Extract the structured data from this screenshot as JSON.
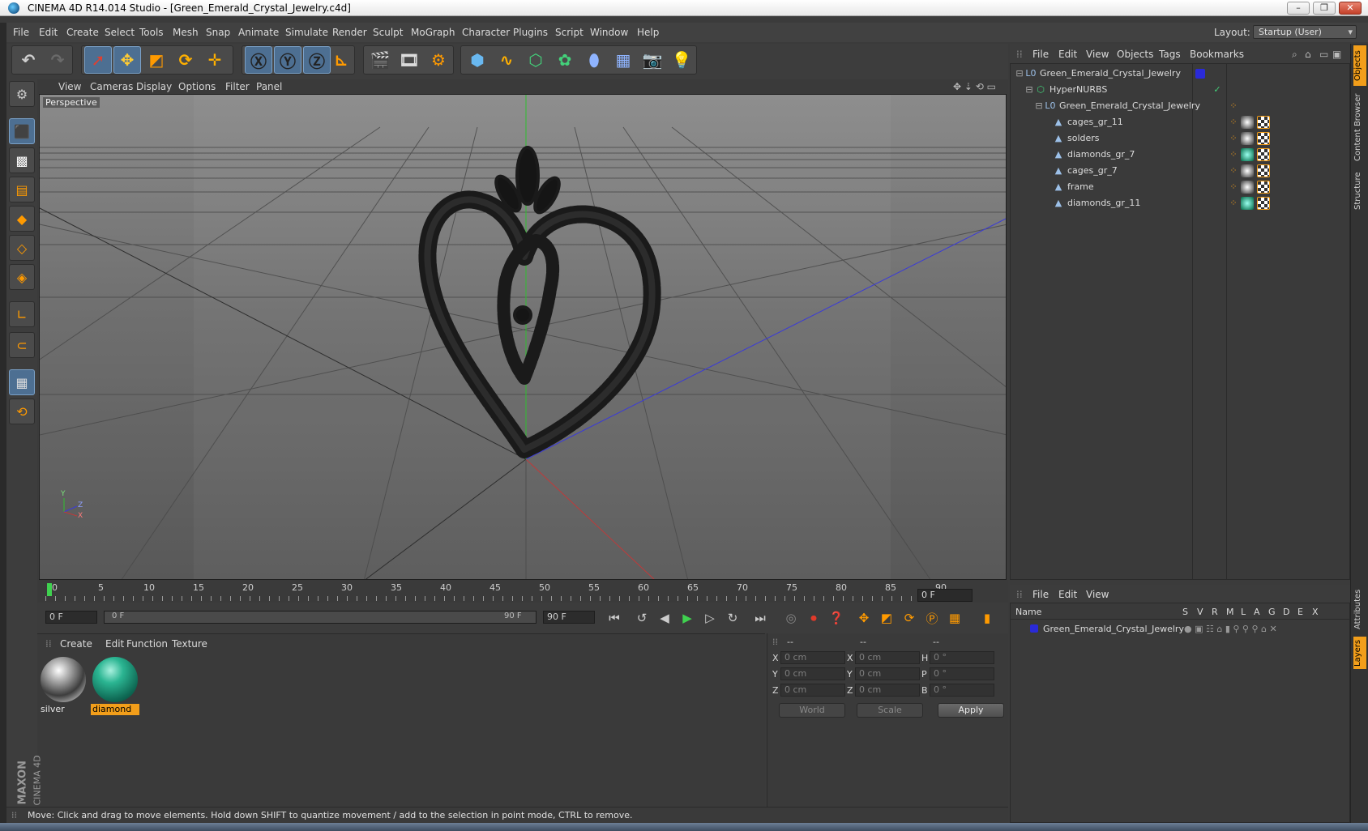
{
  "window": {
    "title": "CINEMA 4D R14.014 Studio - [Green_Emerald_Crystal_Jewelry.c4d]"
  },
  "menubar": {
    "items": [
      "File",
      "Edit",
      "Create",
      "Select",
      "Tools",
      "Mesh",
      "Snap",
      "Animate",
      "Simulate",
      "Render",
      "Sculpt",
      "MoGraph",
      "Character",
      "Plugins",
      "Script",
      "Window",
      "Help"
    ],
    "layout_label": "Layout:",
    "layout_value": "Startup (User)"
  },
  "viewport": {
    "menu": [
      "View",
      "Cameras",
      "Display",
      "Options",
      "Filter",
      "Panel"
    ],
    "label": "Perspective",
    "axis_labels": {
      "y": "Y",
      "z": "Z",
      "x": "X"
    }
  },
  "timeline": {
    "ticks": [
      "0",
      "5",
      "10",
      "15",
      "20",
      "25",
      "30",
      "35",
      "40",
      "45",
      "50",
      "55",
      "60",
      "65",
      "70",
      "75",
      "80",
      "85",
      "90"
    ],
    "current_frame": "0 F",
    "start_field": "0 F",
    "range_start": "0 F",
    "range_end": "90 F",
    "end_field": "90 F"
  },
  "materials": {
    "menu": [
      "Create",
      "Edit",
      "Function",
      "Texture"
    ],
    "items": [
      {
        "name": "silver",
        "selected": false
      },
      {
        "name": "diamond",
        "selected": true
      }
    ]
  },
  "coordinates": {
    "headers": [
      "--",
      "--",
      "--"
    ],
    "rows": [
      {
        "l1": "X",
        "v1": "0 cm",
        "l2": "X",
        "v2": "0 cm",
        "l3": "H",
        "v3": "0 °"
      },
      {
        "l1": "Y",
        "v1": "0 cm",
        "l2": "Y",
        "v2": "0 cm",
        "l3": "P",
        "v3": "0 °"
      },
      {
        "l1": "Z",
        "v1": "0 cm",
        "l2": "Z",
        "v2": "0 cm",
        "l3": "B",
        "v3": "0 °"
      }
    ],
    "world_select": "World",
    "scale_select": "Scale",
    "apply_label": "Apply"
  },
  "status": {
    "text": "Move: Click and drag to move elements. Hold down SHIFT to quantize movement / add to the selection in point mode, CTRL to remove."
  },
  "object_manager": {
    "menu": [
      "File",
      "Edit",
      "View",
      "Objects",
      "Tags",
      "Bookmarks"
    ],
    "objects": [
      {
        "name": "Green_Emerald_Crystal_Jewelry",
        "indent": 0,
        "icon": "null-icon"
      },
      {
        "name": "HyperNURBS",
        "indent": 1,
        "icon": "hypernurbs-icon"
      },
      {
        "name": "Green_Emerald_Crystal_Jewelry",
        "indent": 2,
        "icon": "null-icon"
      },
      {
        "name": "cages_gr_11",
        "indent": 3,
        "icon": "polygon-icon"
      },
      {
        "name": "solders",
        "indent": 3,
        "icon": "polygon-icon"
      },
      {
        "name": "diamonds_gr_7",
        "indent": 3,
        "icon": "polygon-icon"
      },
      {
        "name": "cages_gr_7",
        "indent": 3,
        "icon": "polygon-icon"
      },
      {
        "name": "frame",
        "indent": 3,
        "icon": "polygon-icon"
      },
      {
        "name": "diamonds_gr_11",
        "indent": 3,
        "icon": "polygon-icon"
      }
    ]
  },
  "layer_manager": {
    "menu": [
      "File",
      "Edit",
      "View"
    ],
    "columns": [
      "Name",
      "S",
      "V",
      "R",
      "M",
      "L",
      "A",
      "G",
      "D",
      "E",
      "X"
    ],
    "layers": [
      {
        "name": "Green_Emerald_Crystal_Jewelry",
        "color": "#2a2ad8"
      }
    ]
  },
  "right_tabs": [
    "Objects",
    "Content Browser",
    "Structure",
    "Attributes",
    "Layers"
  ],
  "brand": {
    "maxon": "MAXON",
    "c4d": "CINEMA 4D"
  },
  "colors": {
    "accent_orange": "#f29e1a",
    "selection_blue": "#4d6f92",
    "layer_blue": "#2a2ad8"
  }
}
